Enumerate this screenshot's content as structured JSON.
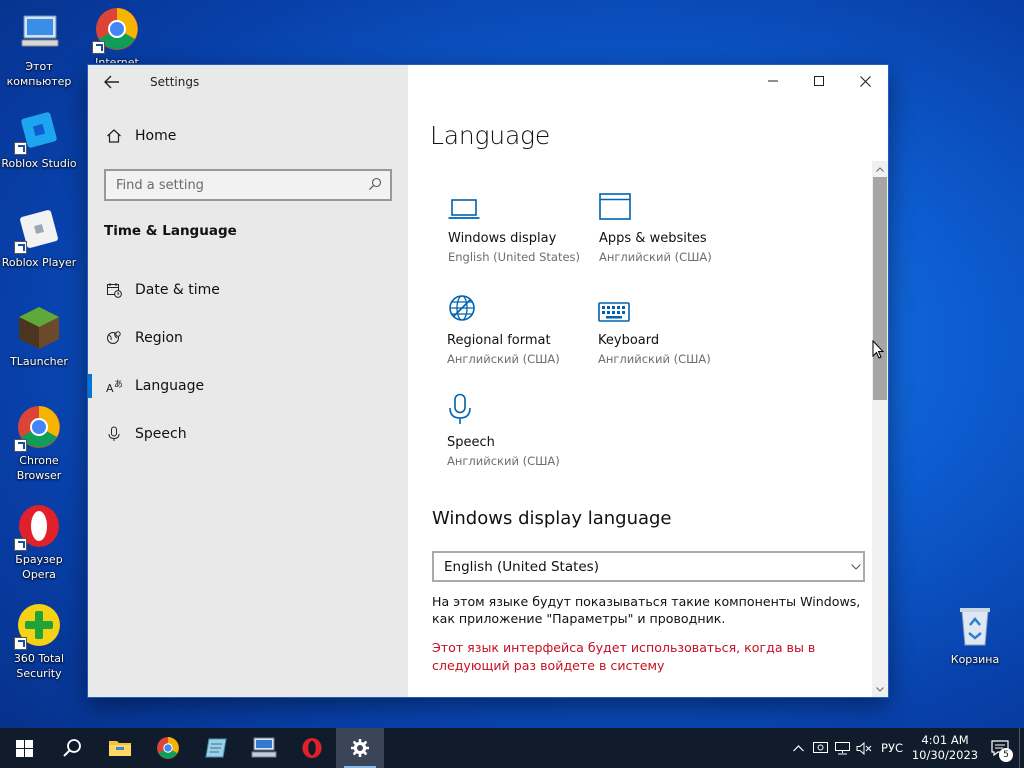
{
  "desktop": {
    "icons": [
      {
        "label": "Этот компьютер",
        "icon": "this-pc-icon"
      },
      {
        "label": "Internet Studio",
        "icon": "chrome-icon"
      },
      {
        "label": "Roblox Studio",
        "icon": "roblox-studio-icon"
      },
      {
        "label": "Roblox Player",
        "icon": "roblox-player-icon"
      },
      {
        "label": "TLauncher",
        "icon": "tlauncher-icon"
      },
      {
        "label": "Chrone Browser",
        "icon": "chrome-icon"
      },
      {
        "label": "Браузер Opera",
        "icon": "opera-icon"
      },
      {
        "label": "360 Total Security",
        "icon": "360-security-icon"
      },
      {
        "label": "Корзина",
        "icon": "recycle-bin-icon"
      }
    ]
  },
  "window": {
    "title": "Settings",
    "sidebar": {
      "home": "Home",
      "search_placeholder": "Find a setting",
      "section": "Time & Language",
      "items": [
        {
          "label": "Date & time",
          "icon": "date-time-icon"
        },
        {
          "label": "Region",
          "icon": "region-icon"
        },
        {
          "label": "Language",
          "icon": "language-icon",
          "selected": true
        },
        {
          "label": "Speech",
          "icon": "microphone-icon"
        }
      ]
    },
    "content": {
      "title": "Language",
      "tiles": [
        {
          "name": "Windows display",
          "sub": "English (United States)",
          "icon": "laptop-icon"
        },
        {
          "name": "Apps & websites",
          "sub": "Английский (США)",
          "icon": "window-icon"
        },
        {
          "name": "Regional format",
          "sub": "Английский (США)",
          "icon": "globe-icon"
        },
        {
          "name": "Keyboard",
          "sub": "Английский (США)",
          "icon": "keyboard-icon"
        },
        {
          "name": "Speech",
          "sub": "Английский (США)",
          "icon": "microphone-icon"
        }
      ],
      "display_language_heading": "Windows display language",
      "display_language_value": "English (United States)",
      "description": "На этом языке будут показываться такие компоненты Windows, как приложение \"Параметры\" и проводник.",
      "warning": "Этот язык интерфейса будет использоваться, когда вы в следующий раз войдете в систему"
    }
  },
  "taskbar": {
    "language": "РУС",
    "time": "4:01 AM",
    "date": "10/30/2023",
    "notification_count": "5"
  },
  "colors": {
    "accent": "#0078d7",
    "warning": "#c50f1f",
    "taskbar": "#101c2c"
  }
}
